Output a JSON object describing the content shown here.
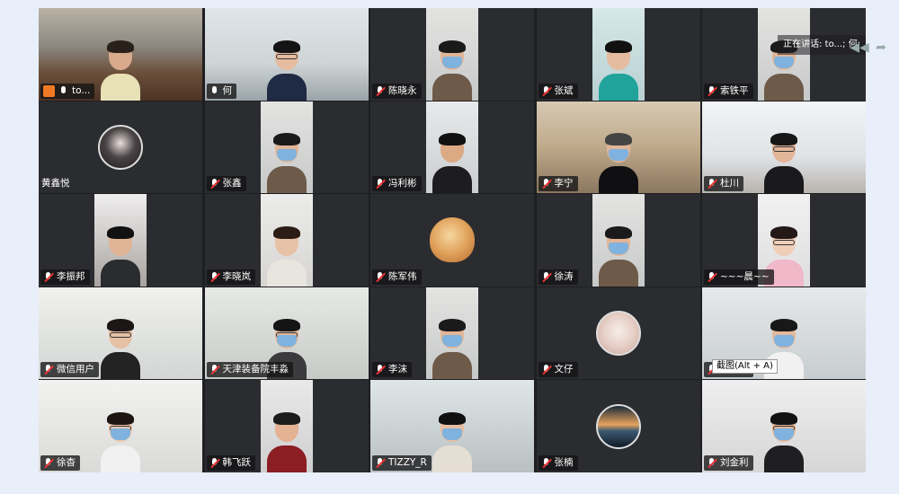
{
  "speaking": {
    "text": "正在讲话: to...; 何;"
  },
  "tooltip": {
    "text": "截图(Alt + A)"
  },
  "corner_buttons": [
    {
      "icon": "double-chevron-icon"
    },
    {
      "icon": "pin-icon"
    }
  ],
  "participants": [
    {
      "name": "to...",
      "mic": "on",
      "kind": "video",
      "scene": "conference-room",
      "wide": true
    },
    {
      "name": "何",
      "mic": "on",
      "kind": "video",
      "scene": "office-window",
      "wide": true
    },
    {
      "name": "陈晓永",
      "mic": "off",
      "kind": "video",
      "scene": "narrow-mask"
    },
    {
      "name": "张斌",
      "mic": "off",
      "kind": "video",
      "scene": "narrow-teal"
    },
    {
      "name": "索铁平",
      "mic": "off",
      "kind": "video",
      "scene": "narrow-mask"
    },
    {
      "name": "黄鑫悦",
      "mic": "none",
      "kind": "avatar",
      "scene": "avatar-dark"
    },
    {
      "name": "张鑫",
      "mic": "off",
      "kind": "video",
      "scene": "narrow-mask"
    },
    {
      "name": "冯利彬",
      "mic": "off",
      "kind": "video",
      "scene": "narrow-plain"
    },
    {
      "name": "李宁",
      "mic": "off",
      "kind": "video",
      "scene": "shelf-room",
      "wide": true
    },
    {
      "name": "杜川",
      "mic": "off",
      "kind": "video",
      "scene": "office-bright",
      "wide": true
    },
    {
      "name": "李振邦",
      "mic": "off",
      "kind": "video",
      "scene": "narrow-office"
    },
    {
      "name": "李晓岚",
      "mic": "off",
      "kind": "video",
      "scene": "narrow-woman"
    },
    {
      "name": "陈军伟",
      "mic": "off",
      "kind": "avatar",
      "scene": "avatar-lamp"
    },
    {
      "name": "徐涛",
      "mic": "off",
      "kind": "video",
      "scene": "narrow-mask"
    },
    {
      "name": "~~~晨~~",
      "mic": "off",
      "kind": "video",
      "scene": "narrow-woman-pink"
    },
    {
      "name": "微信用户",
      "mic": "off",
      "kind": "video",
      "scene": "wide-closeup",
      "wide": true
    },
    {
      "name": "天津装备院丰淼",
      "mic": "off",
      "kind": "video",
      "scene": "wide-office-mask",
      "wide": true
    },
    {
      "name": "李沫",
      "mic": "off",
      "kind": "video",
      "scene": "narrow-mask"
    },
    {
      "name": "文仔",
      "mic": "off",
      "kind": "avatar",
      "scene": "avatar-girl"
    },
    {
      "name": "刘佩泉",
      "mic": "off",
      "kind": "video",
      "scene": "cabinet-room",
      "wide": true
    },
    {
      "name": "徐杳",
      "mic": "off",
      "kind": "video",
      "scene": "wide-girl-mask",
      "wide": true
    },
    {
      "name": "韩飞跃",
      "mic": "off",
      "kind": "video",
      "scene": "narrow-red"
    },
    {
      "name": "TIZZY_R",
      "mic": "off",
      "kind": "video",
      "scene": "wide-lab-mask",
      "wide": true
    },
    {
      "name": "张楠",
      "mic": "off",
      "kind": "avatar",
      "scene": "avatar-sunset"
    },
    {
      "name": "刘金利",
      "mic": "off",
      "kind": "video",
      "scene": "wide-room-mask",
      "wide": true
    }
  ]
}
